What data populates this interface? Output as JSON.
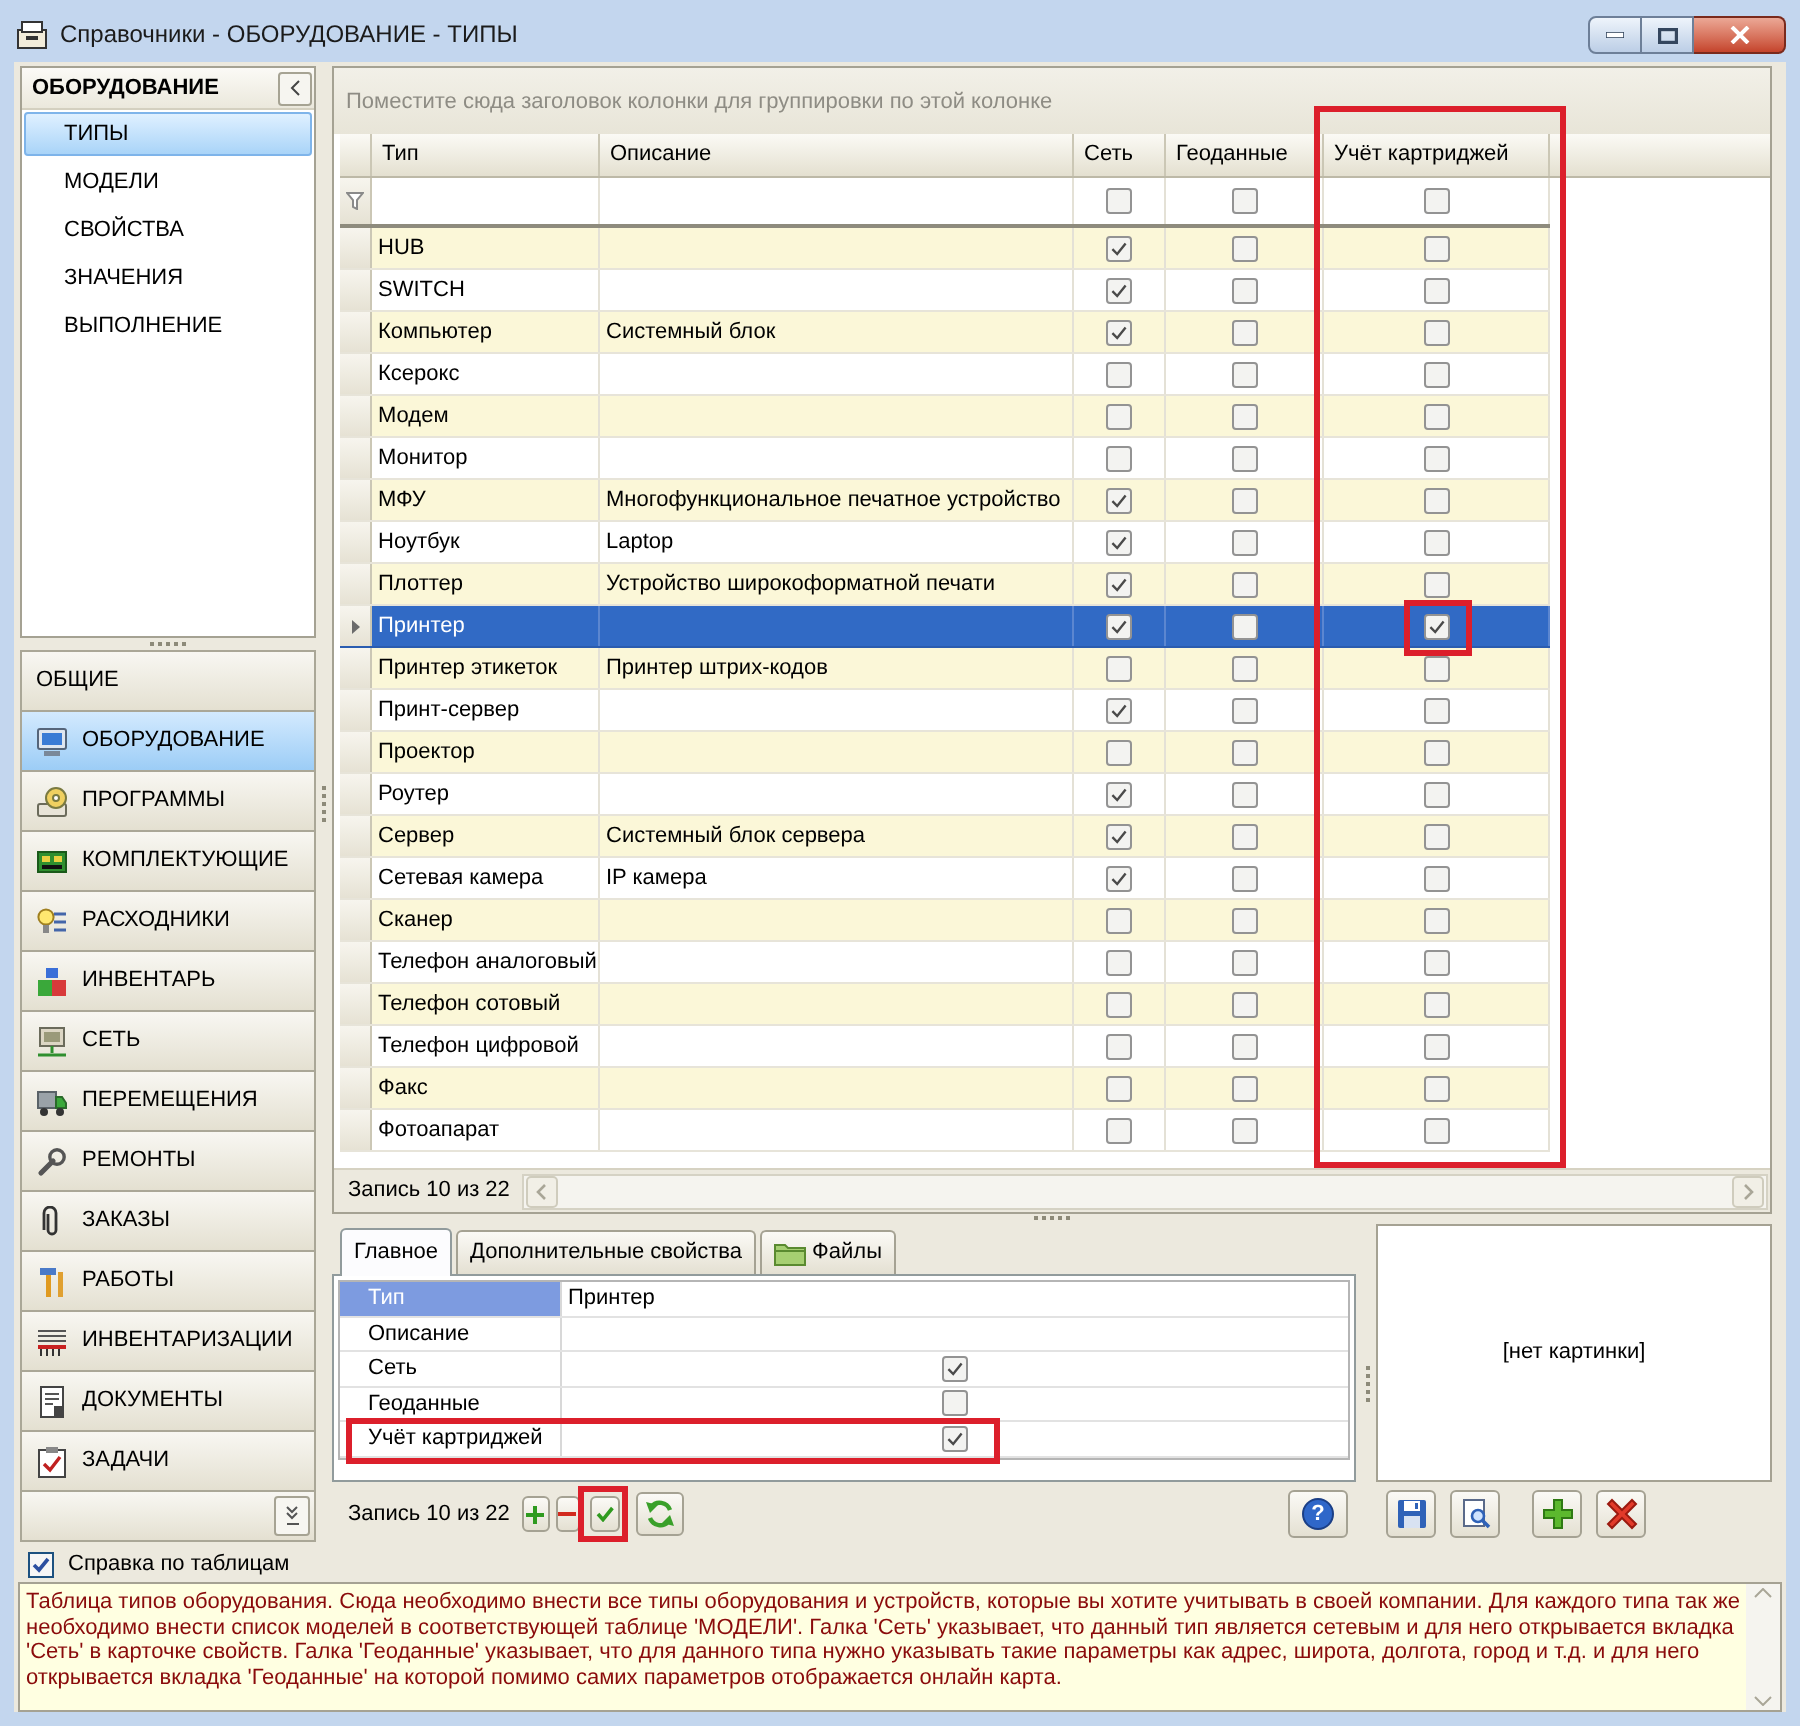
{
  "window": {
    "title": "Справочники - ОБОРУДОВАНИЕ - ТИПЫ"
  },
  "sidebar": {
    "panel": {
      "title": "ОБОРУДОВАНИЕ",
      "items": [
        {
          "label": "ТИПЫ",
          "selected": true
        },
        {
          "label": "МОДЕЛИ",
          "selected": false
        },
        {
          "label": "СВОЙСТВА",
          "selected": false
        },
        {
          "label": "ЗНАЧЕНИЯ",
          "selected": false
        },
        {
          "label": "ВЫПОЛНЕНИЕ",
          "selected": false
        }
      ]
    },
    "groups": [
      {
        "label": "ОБЩИЕ",
        "selected": false
      },
      {
        "label": "ОБОРУДОВАНИЕ",
        "selected": true
      },
      {
        "label": "ПРОГРАММЫ",
        "selected": false
      },
      {
        "label": "КОМПЛЕКТУЮЩИЕ",
        "selected": false
      },
      {
        "label": "РАСХОДНИКИ",
        "selected": false
      },
      {
        "label": "ИНВЕНТАРЬ",
        "selected": false
      },
      {
        "label": "СЕТЬ",
        "selected": false
      },
      {
        "label": "ПЕРЕМЕЩЕНИЯ",
        "selected": false
      },
      {
        "label": "РЕМОНТЫ",
        "selected": false
      },
      {
        "label": "ЗАКАЗЫ",
        "selected": false
      },
      {
        "label": "РАБОТЫ",
        "selected": false
      },
      {
        "label": "ИНВЕНТАРИЗАЦИИ",
        "selected": false
      },
      {
        "label": "ДОКУМЕНТЫ",
        "selected": false
      },
      {
        "label": "ЗАДАЧИ",
        "selected": false
      }
    ]
  },
  "grid": {
    "group_hint": "Поместите сюда заголовок колонки для группировки по этой колонке",
    "columns": [
      {
        "title": "Тип",
        "highlighted": false
      },
      {
        "title": "Описание",
        "highlighted": false
      },
      {
        "title": "Сеть",
        "highlighted": false
      },
      {
        "title": "Геоданные",
        "highlighted": false
      },
      {
        "title": "Учёт картриджей",
        "highlighted": true
      }
    ],
    "filter_row": [
      {
        "checked": false
      },
      {
        "checked": false
      },
      {
        "checked": false
      }
    ],
    "rows": [
      {
        "type": "HUB",
        "network": true,
        "geodata": false,
        "cartridges": false,
        "cartridges_marked": false,
        "selected": false
      },
      {
        "type": "SWITCH",
        "network": true,
        "geodata": false,
        "cartridges": false,
        "cartridges_marked": false,
        "selected": false
      },
      {
        "type": "Компьютер",
        "description": "Системный блок",
        "network": true,
        "geodata": false,
        "cartridges": false,
        "cartridges_marked": false,
        "selected": false
      },
      {
        "type": "Ксерокс",
        "network": false,
        "geodata": false,
        "cartridges": false,
        "cartridges_marked": false,
        "selected": false
      },
      {
        "type": "Модем",
        "network": false,
        "geodata": false,
        "cartridges": false,
        "cartridges_marked": false,
        "selected": false
      },
      {
        "type": "Монитор",
        "network": false,
        "geodata": false,
        "cartridges": false,
        "cartridges_marked": false,
        "selected": false
      },
      {
        "type": "МФУ",
        "description": "Многофункциональное печатное устройство",
        "network": true,
        "geodata": false,
        "cartridges": false,
        "cartridges_marked": false,
        "selected": false
      },
      {
        "type": "Ноутбук",
        "description": "Laptop",
        "network": true,
        "geodata": false,
        "cartridges": false,
        "cartridges_marked": false,
        "selected": false
      },
      {
        "type": "Плоттер",
        "description": "Устройство широкоформатной печати",
        "network": true,
        "geodata": false,
        "cartridges": false,
        "cartridges_marked": false,
        "selected": false
      },
      {
        "type": "Принтер",
        "network": true,
        "geodata": false,
        "cartridges": true,
        "cartridges_marked": true,
        "selected": true
      },
      {
        "type": "Принтер этикеток",
        "description": "Принтер штрих-кодов",
        "network": false,
        "geodata": false,
        "cartridges": false,
        "cartridges_marked": false,
        "selected": false
      },
      {
        "type": "Принт-сервер",
        "network": true,
        "geodata": false,
        "cartridges": false,
        "cartridges_marked": false,
        "selected": false
      },
      {
        "type": "Проектор",
        "network": false,
        "geodata": false,
        "cartridges": false,
        "cartridges_marked": false,
        "selected": false
      },
      {
        "type": "Роутер",
        "network": true,
        "geodata": false,
        "cartridges": false,
        "cartridges_marked": false,
        "selected": false
      },
      {
        "type": "Сервер",
        "description": "Системный блок сервера",
        "network": true,
        "geodata": false,
        "cartridges": false,
        "cartridges_marked": false,
        "selected": false
      },
      {
        "type": "Сетевая камера",
        "description": "IP камера",
        "network": true,
        "geodata": false,
        "cartridges": false,
        "cartridges_marked": false,
        "selected": false
      },
      {
        "type": "Сканер",
        "network": false,
        "geodata": false,
        "cartridges": false,
        "cartridges_marked": false,
        "selected": false
      },
      {
        "type": "Телефон аналоговый",
        "network": false,
        "geodata": false,
        "cartridges": false,
        "cartridges_marked": false,
        "selected": false
      },
      {
        "type": "Телефон сотовый",
        "network": false,
        "geodata": false,
        "cartridges": false,
        "cartridges_marked": false,
        "selected": false
      },
      {
        "type": "Телефон цифровой",
        "network": false,
        "geodata": false,
        "cartridges": false,
        "cartridges_marked": false,
        "selected": false
      },
      {
        "type": "Факс",
        "network": false,
        "geodata": false,
        "cartridges": false,
        "cartridges_marked": false,
        "selected": false
      },
      {
        "type": "Фотоапарат",
        "network": false,
        "geodata": false,
        "cartridges": false,
        "cartridges_marked": false,
        "selected": false
      }
    ],
    "record_counter": "Запись 10 из 22"
  },
  "detail": {
    "tabs": [
      {
        "label": "Главное",
        "selected": true
      },
      {
        "label": "Дополнительные свойства",
        "selected": false
      },
      {
        "label": "Файлы",
        "selected": false
      }
    ],
    "fields": [
      {
        "label": "Тип",
        "kind": "text",
        "value": "Принтер",
        "selected": true,
        "highlighted": false
      },
      {
        "label": "Описание",
        "kind": "text",
        "selected": false,
        "highlighted": false
      },
      {
        "label": "Сеть",
        "kind": "check",
        "checked": true,
        "selected": false,
        "highlighted": false
      },
      {
        "label": "Геоданные",
        "kind": "check",
        "checked": false,
        "selected": false,
        "highlighted": false
      },
      {
        "label": "Учёт картриджей",
        "kind": "check",
        "checked": true,
        "selected": false,
        "highlighted": true
      }
    ],
    "record_counter": "Запись 10 из 22",
    "nav_buttons": [
      {
        "kind": "add",
        "highlighted": false
      },
      {
        "kind": "remove",
        "highlighted": false
      },
      {
        "kind": "apply",
        "highlighted": true
      },
      {
        "kind": "refresh",
        "highlighted": false
      }
    ],
    "help_button": "?",
    "picture_placeholder": "[нет картинки]"
  },
  "help": {
    "toggle": {
      "label": "Справка по таблицам",
      "checked": true
    },
    "text": "Таблица типов оборудования. Сюда необходимо внести все типы оборудования и устройств, которые вы хотите учитывать в своей компании. Для каждого типа так же необходимо внести список моделей в соответствующей таблице 'МОДЕЛИ'. Галка 'Сеть' указывает, что данный тип является сетевым и для него открывается вкладка 'Сеть' в карточке свойств. Галка 'Геоданные' указывает, что для данного типа нужно указывать такие параметры как адрес, широта, долгота, город и т.д. и для него открывается вкладка 'Геоданные' на которой помимо самих параметров отображается онлайн карта."
  }
}
